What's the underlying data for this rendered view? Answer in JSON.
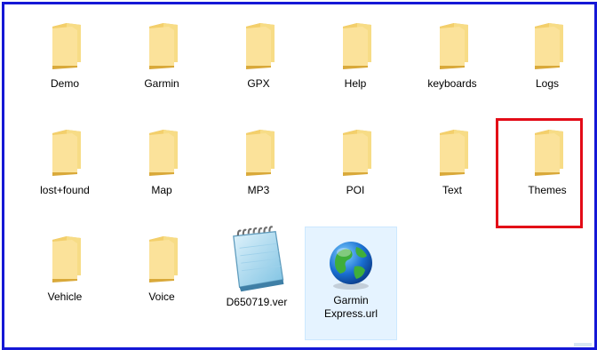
{
  "accent": "#1518d6",
  "highlight_color": "#e30b17",
  "items": [
    {
      "label": "Demo",
      "icon": "folder-icon"
    },
    {
      "label": "Garmin",
      "icon": "folder-icon"
    },
    {
      "label": "GPX",
      "icon": "folder-icon"
    },
    {
      "label": "Help",
      "icon": "folder-icon"
    },
    {
      "label": "keyboards",
      "icon": "folder-icon"
    },
    {
      "label": "Logs",
      "icon": "folder-icon"
    },
    {
      "label": "lost+found",
      "icon": "folder-icon"
    },
    {
      "label": "Map",
      "icon": "folder-icon"
    },
    {
      "label": "MP3",
      "icon": "folder-icon"
    },
    {
      "label": "POI",
      "icon": "folder-icon"
    },
    {
      "label": "Text",
      "icon": "folder-icon"
    },
    {
      "label": "Themes",
      "icon": "folder-icon",
      "highlighted": true
    },
    {
      "label": "Vehicle",
      "icon": "folder-icon"
    },
    {
      "label": "Voice",
      "icon": "folder-icon"
    },
    {
      "label": "D650719.ver",
      "icon": "notepad-file-icon"
    },
    {
      "label": "Garmin Express.url",
      "icon": "globe-internet-shortcut-icon",
      "selected": true
    }
  ]
}
